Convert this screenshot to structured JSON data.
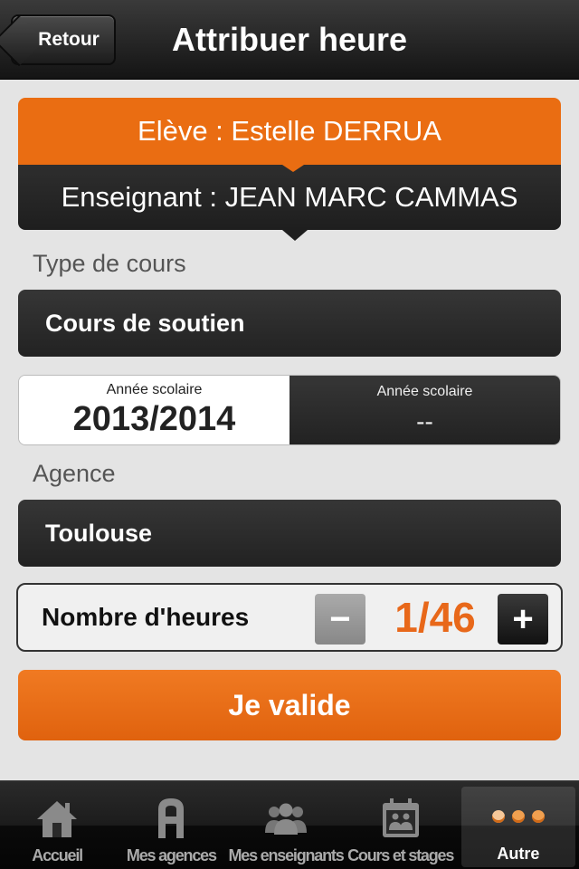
{
  "navbar": {
    "back_label": "Retour",
    "title": "Attribuer heure"
  },
  "card": {
    "student": "Elève : Estelle DERRUA",
    "teacher": "Enseignant : JEAN MARC CAMMAS"
  },
  "course_type": {
    "label": "Type de cours",
    "value": "Cours de soutien"
  },
  "school_year": {
    "options": [
      {
        "label": "Année scolaire",
        "value": "2013/2014",
        "selected": true
      },
      {
        "label": "Année scolaire",
        "value": "--",
        "selected": false
      }
    ]
  },
  "agency": {
    "label": "Agence",
    "value": "Toulouse"
  },
  "hours": {
    "label": "Nombre d'heures",
    "minus": "−",
    "plus": "+",
    "value": "1/46"
  },
  "validate_label": "Je valide",
  "tabs": [
    {
      "label": "Accueil",
      "icon": "house-icon",
      "active": false
    },
    {
      "label": "Mes agences",
      "icon": "agency-a-icon",
      "active": false
    },
    {
      "label": "Mes enseignants",
      "icon": "people-icon",
      "active": false
    },
    {
      "label": "Cours et stages",
      "icon": "calendar-icon",
      "active": false
    },
    {
      "label": "Autre",
      "icon": "more-dots-icon",
      "active": true
    }
  ],
  "colors": {
    "accent": "#ea6d12",
    "dark": "#222222",
    "background": "#e4e4e4"
  }
}
